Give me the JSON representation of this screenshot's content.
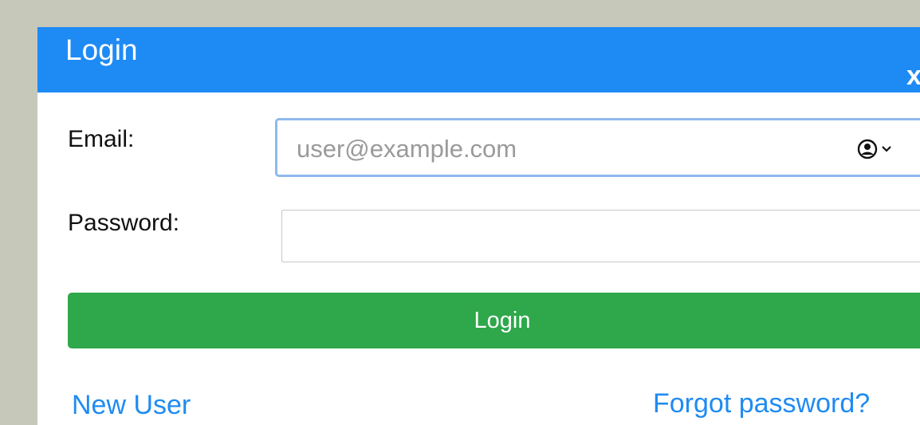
{
  "dialog": {
    "title": "Login",
    "close_glyph": "x",
    "close_icon": "close-icon"
  },
  "form": {
    "email_label": "Email:",
    "email_placeholder": "user@example.com",
    "email_value": "",
    "autofill_icon": "user-circle-icon",
    "autofill_chevron_icon": "chevron-down-icon",
    "password_label": "Password:",
    "password_value": "",
    "login_label": "Login"
  },
  "links": {
    "new_user": "New User",
    "forgot_password": "Forgot password?"
  },
  "colors": {
    "background": "#c6c8b9",
    "titlebar": "#1e8bf5",
    "login_button": "#2ea84a",
    "link": "#1f8bf2",
    "focus_ring": "#8fb8ec"
  }
}
